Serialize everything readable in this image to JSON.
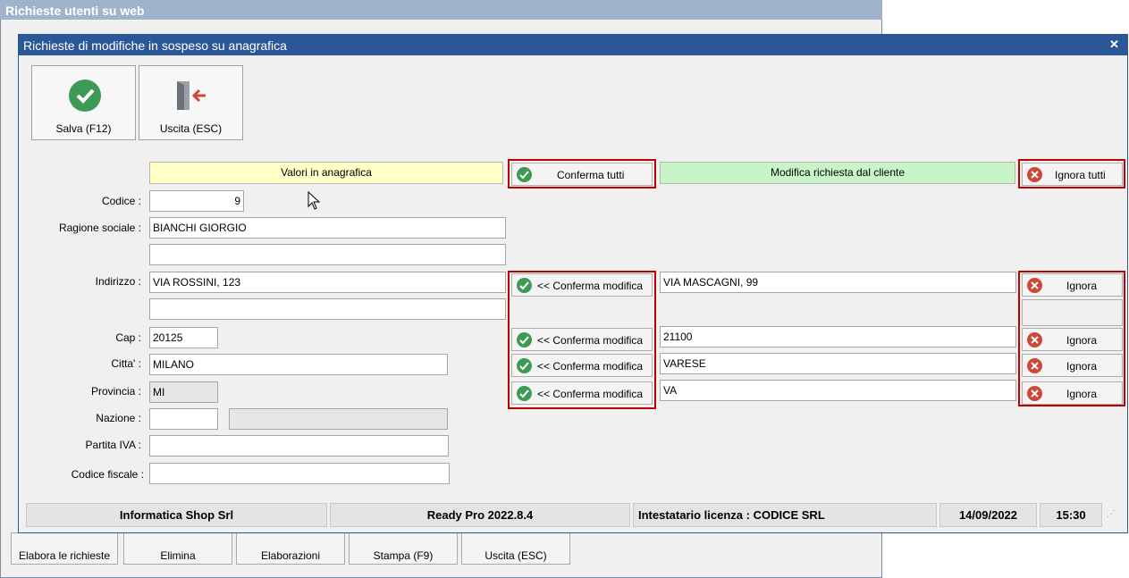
{
  "bg_window": {
    "title": "Richieste utenti su web",
    "buttons": [
      "Elabora le richieste",
      "Elimina",
      "Elaborazioni",
      "Stampa (F9)",
      "Uscita (ESC)"
    ]
  },
  "dialog": {
    "title": "Richieste di modifiche in sospeso su anagrafica",
    "toolbar": {
      "save_label": "Salva (F12)",
      "exit_label": "Uscita (ESC)"
    },
    "headers": {
      "current": "Valori in anagrafica",
      "confirm_all": "Conferma tutti",
      "requested": "Modifica richiesta dal cliente",
      "ignore_all": "Ignora tutti"
    },
    "labels": {
      "codice": "Codice :",
      "ragione": "Ragione sociale :",
      "indirizzo": "Indirizzo :",
      "cap": "Cap :",
      "citta": "Citta' :",
      "provincia": "Provincia :",
      "nazione": "Nazione :",
      "piva": "Partita IVA :",
      "cf": "Codice fiscale :"
    },
    "values": {
      "codice": "9",
      "ragione": "BIANCHI GIORGIO",
      "ragione2": "",
      "indirizzo": "VIA ROSSINI, 123",
      "indirizzo2": "",
      "cap": "20125",
      "citta": "MILANO",
      "provincia": "MI",
      "nazione": "",
      "nazione_desc": "",
      "piva": "",
      "cf": ""
    },
    "requested": {
      "indirizzo": "VIA MASCAGNI, 99",
      "cap": "21100",
      "citta": "VARESE",
      "provincia": "VA"
    },
    "confirm_label": "<< Conferma modifica",
    "ignore_label": "Ignora"
  },
  "status": {
    "company": "Informatica Shop Srl",
    "version": "Ready Pro 2022.8.4",
    "license": "Intestatario licenza : CODICE SRL",
    "date": "14/09/2022",
    "time": "15:30"
  },
  "colors": {
    "title_bar": "#2b5797",
    "highlight_box": "#c00000",
    "ok": "#3d9a55",
    "cancel": "#d0473a"
  }
}
